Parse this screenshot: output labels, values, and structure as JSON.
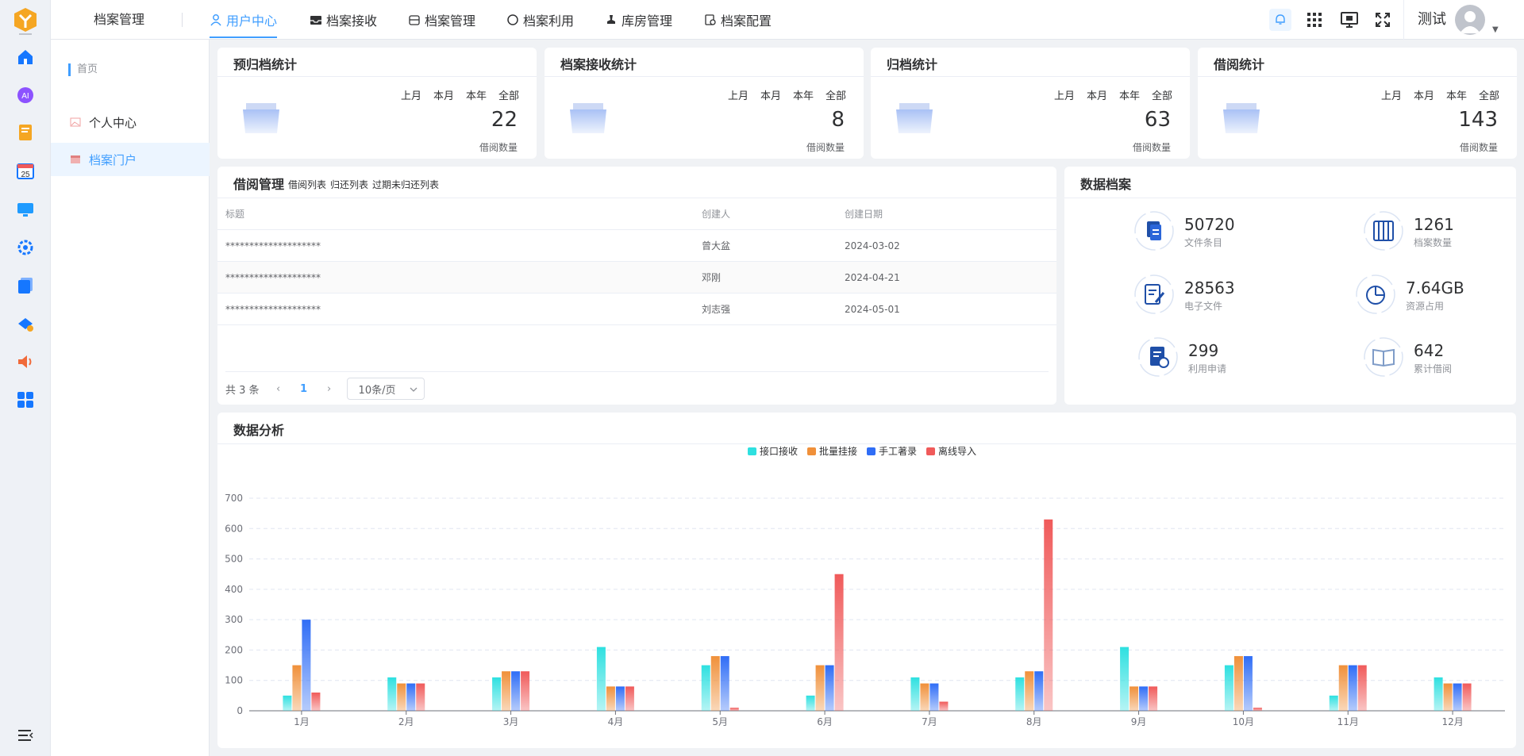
{
  "app": {
    "system_title": "档案管理",
    "user_name": "测试"
  },
  "nav": [
    {
      "label": "用户中心",
      "icon": "user-icon",
      "active": true
    },
    {
      "label": "档案接收",
      "icon": "inbox-icon",
      "active": false
    },
    {
      "label": "档案管理",
      "icon": "archive-box-icon",
      "active": false
    },
    {
      "label": "档案利用",
      "icon": "circle-icon",
      "active": false
    },
    {
      "label": "库房管理",
      "icon": "stamp-icon",
      "active": false
    },
    {
      "label": "档案配置",
      "icon": "document-settings-icon",
      "active": false
    }
  ],
  "sidemenu": {
    "breadcrumb": "首页",
    "items": [
      {
        "label": "个人中心",
        "active": false
      },
      {
        "label": "档案门户",
        "active": true
      }
    ]
  },
  "stats": [
    {
      "title": "预归档统计",
      "periods": [
        "上月",
        "本月",
        "本年",
        "全部"
      ],
      "value": "22",
      "sub": "借阅数量"
    },
    {
      "title": "档案接收统计",
      "periods": [
        "上月",
        "本月",
        "本年",
        "全部"
      ],
      "value": "8",
      "sub": "借阅数量"
    },
    {
      "title": "归档统计",
      "periods": [
        "上月",
        "本月",
        "本年",
        "全部"
      ],
      "value": "63",
      "sub": "借阅数量"
    },
    {
      "title": "借阅统计",
      "periods": [
        "上月",
        "本月",
        "本年",
        "全部"
      ],
      "value": "143",
      "sub": "借阅数量"
    }
  ],
  "borrow": {
    "title": "借阅管理",
    "tabs": [
      "借阅列表",
      "归还列表",
      "过期未归还列表"
    ],
    "columns": [
      "标题",
      "创建人",
      "创建日期"
    ],
    "rows": [
      {
        "title": "********************",
        "creator": "曾大盆",
        "date": "2024-03-02"
      },
      {
        "title": "********************",
        "creator": "邓刚",
        "date": "2024-04-21"
      },
      {
        "title": "********************",
        "creator": "刘志强",
        "date": "2024-05-01"
      }
    ],
    "total": "共 3 条",
    "current_page": "1",
    "page_size": "10条/页"
  },
  "archive": {
    "title": "数据档案",
    "items": [
      {
        "value": "50720",
        "label": "文件条目",
        "icon": "file-stack-icon"
      },
      {
        "value": "1261",
        "label": "档案数量",
        "icon": "binders-icon"
      },
      {
        "value": "28563",
        "label": "电子文件",
        "icon": "edit-document-icon"
      },
      {
        "value": "7.64GB",
        "label": "资源占用",
        "icon": "pie-chart-icon"
      },
      {
        "value": "299",
        "label": "利用申请",
        "icon": "document-clock-icon"
      },
      {
        "value": "642",
        "label": "累计借阅",
        "icon": "open-book-icon"
      }
    ]
  },
  "analysis": {
    "title": "数据分析"
  },
  "chart_data": {
    "type": "bar",
    "categories": [
      "1月",
      "2月",
      "3月",
      "4月",
      "5月",
      "6月",
      "7月",
      "8月",
      "9月",
      "10月",
      "11月",
      "12月"
    ],
    "series": [
      {
        "name": "接口接收",
        "color": "#2ee0e0",
        "values": [
          50,
          110,
          110,
          210,
          150,
          50,
          110,
          110,
          210,
          150,
          50,
          110
        ]
      },
      {
        "name": "批量挂接",
        "color": "#f0903a",
        "values": [
          150,
          90,
          130,
          80,
          180,
          150,
          90,
          130,
          80,
          180,
          150,
          90
        ]
      },
      {
        "name": "手工著录",
        "color": "#2f6df6",
        "values": [
          300,
          90,
          130,
          80,
          180,
          150,
          90,
          130,
          80,
          180,
          150,
          90
        ]
      },
      {
        "name": "离线导入",
        "color": "#f05a5a",
        "values": [
          60,
          90,
          130,
          80,
          10,
          450,
          30,
          630,
          80,
          10,
          150,
          90
        ]
      }
    ],
    "yticks": [
      0,
      100,
      200,
      300,
      400,
      500,
      600,
      700
    ],
    "ylim": [
      0,
      700
    ],
    "grid": true,
    "legend": "top-center"
  }
}
